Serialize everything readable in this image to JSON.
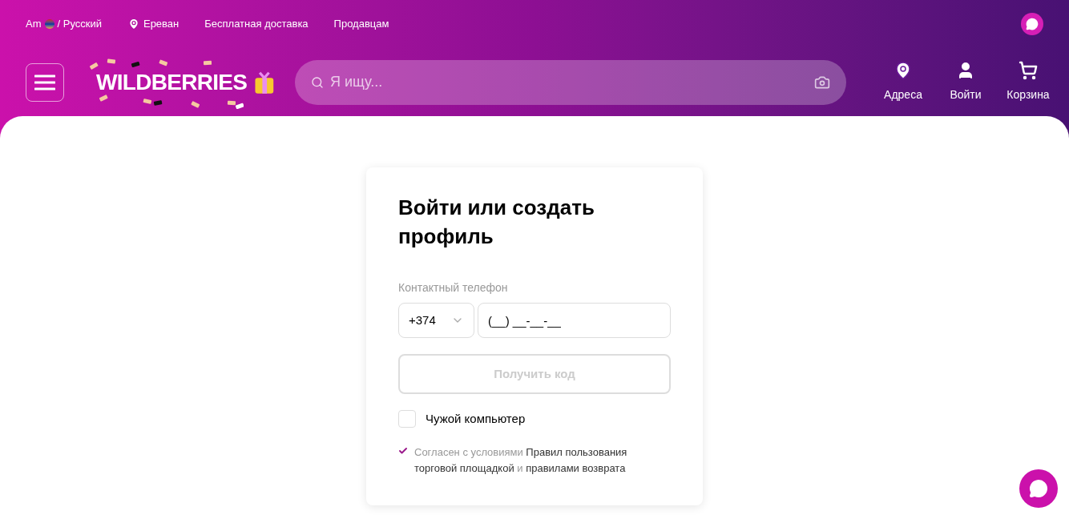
{
  "top_bar": {
    "language": "Am",
    "language_suffix": "/ Русский",
    "city": "Ереван",
    "links": [
      "Бесплатная доставка",
      "Продавцам"
    ]
  },
  "header": {
    "logo": "WILDBERRIES",
    "search": {
      "placeholder": "Я ищу..."
    },
    "actions": [
      {
        "kind": "pin",
        "label": "Адреса"
      },
      {
        "kind": "person",
        "label": "Войти"
      },
      {
        "kind": "cart",
        "label": "Корзина"
      }
    ]
  },
  "login": {
    "title": "Войти или создать профиль",
    "phone_label": "Контактный телефон",
    "country_code": "+374",
    "phone_value": "(__) __-__-__",
    "submit": {
      "label": "Получить код",
      "disabled": true
    },
    "remember": {
      "label": "Чужой компьютер",
      "checked": false
    },
    "consent": {
      "checked": true,
      "parts": [
        {
          "kind": "text",
          "text": "Согласен с условиями "
        },
        {
          "kind": "link",
          "text": "Правил пользования"
        },
        {
          "kind": "link",
          "text": "торговой площадкой"
        },
        {
          "kind": "text",
          "text": " и "
        },
        {
          "kind": "link",
          "text": "правилами возврата"
        }
      ]
    }
  }
}
